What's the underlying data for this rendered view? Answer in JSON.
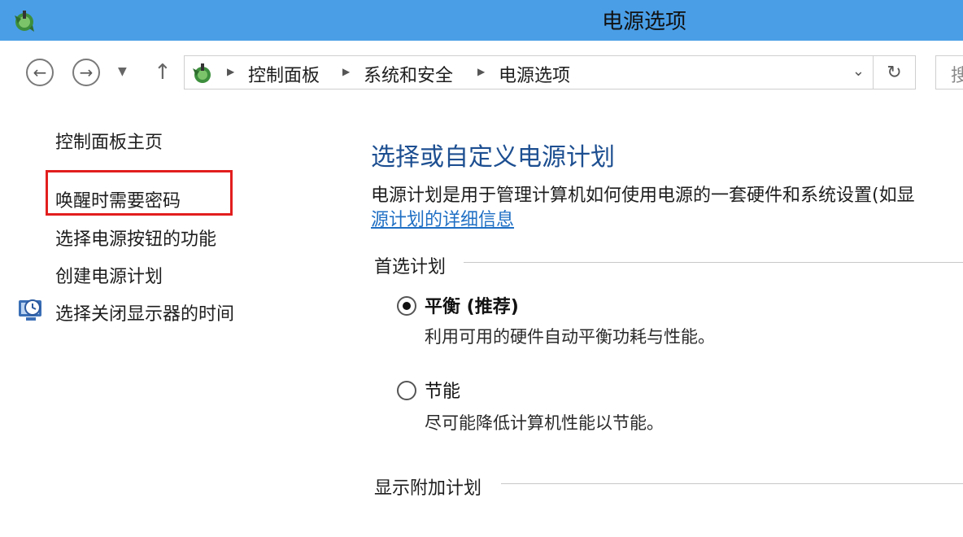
{
  "window": {
    "title": "电源选项",
    "icon": "power-options-icon"
  },
  "nav": {
    "back_icon": "back-arrow-icon",
    "forward_icon": "forward-arrow-icon",
    "history_icon": "chevron-down-icon",
    "up_icon": "up-arrow-icon",
    "breadcrumbs": [
      "控制面板",
      "系统和安全",
      "电源选项"
    ],
    "dropdown_icon": "chevron-down-icon",
    "refresh_icon": "refresh-icon",
    "search_placeholder": "搜"
  },
  "sidebar": {
    "home": "控制面板主页",
    "items": [
      {
        "label": "唤醒时需要密码",
        "highlighted": true
      },
      {
        "label": "选择电源按钮的功能"
      },
      {
        "label": "创建电源计划"
      },
      {
        "label": "选择关闭显示器的时间",
        "icon": "display-clock-icon"
      }
    ],
    "highlight_color": "#e21e1e"
  },
  "main": {
    "heading": "选择或自定义电源计划",
    "description": "电源计划是用于管理计算机如何使用电源的一套硬件和系统设置(如显",
    "link": "源计划的详细信息",
    "preferred_section": "首选计划",
    "plans": [
      {
        "name": "平衡 (推荐)",
        "desc": "利用可用的硬件自动平衡功耗与性能。",
        "selected": true
      },
      {
        "name": "节能",
        "desc": "尽可能降低计算机性能以节能。",
        "selected": false
      }
    ],
    "extra_section": "显示附加计划"
  },
  "colors": {
    "titlebar": "#4a9ee6",
    "heading": "#1d4f91",
    "link": "#1f6fc4"
  }
}
